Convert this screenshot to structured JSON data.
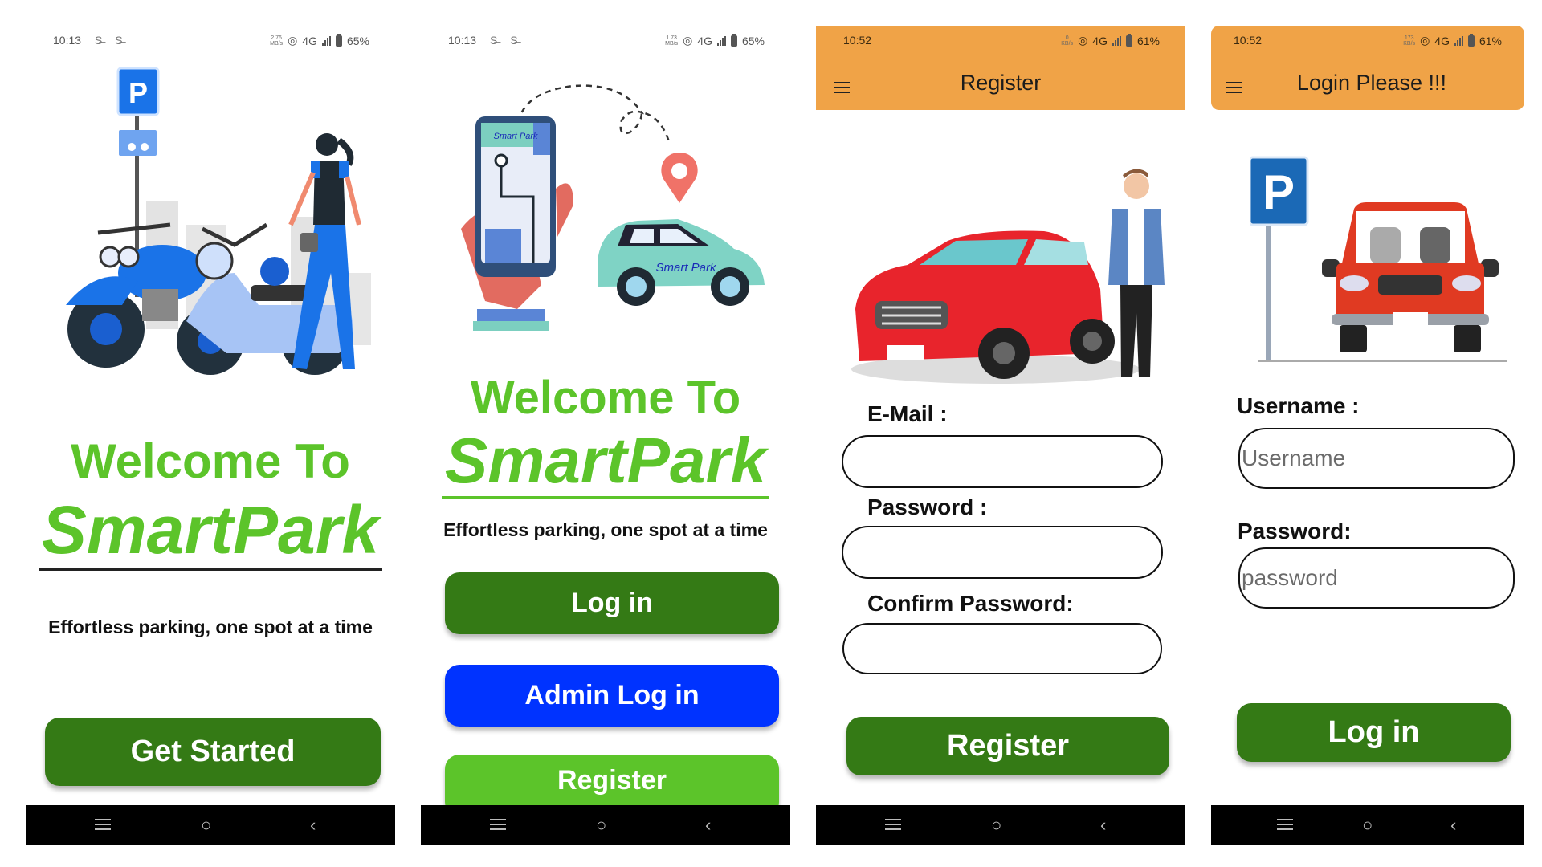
{
  "screens": [
    {
      "id": "welcome",
      "status": {
        "time": "10:13",
        "notif": "S̶ S̶",
        "speed_value": "2.76",
        "speed_unit": "MB/s",
        "network": "4G",
        "battery": "65%"
      },
      "welcome_text": "Welcome To",
      "brand": "SmartPark",
      "tagline": "Effortless parking, one spot at a time",
      "primary_button": "Get Started",
      "illustration": "motorcycles-parking-illustration"
    },
    {
      "id": "home",
      "status": {
        "time": "10:13",
        "notif": "S̶ S̶",
        "speed_value": "1.73",
        "speed_unit": "MB/s",
        "network": "4G",
        "battery": "65%"
      },
      "illustration_phone_label": "Smart Park",
      "illustration_car_label": "Smart Park",
      "welcome_text": "Welcome To",
      "brand": "SmartPark",
      "tagline": "Effortless parking, one spot at a time",
      "buttons": [
        "Log in",
        "Admin Log in",
        "Register"
      ]
    },
    {
      "id": "register",
      "status": {
        "time": "10:52",
        "speed_value": "0",
        "speed_unit": "KB/s",
        "network": "4G",
        "battery": "61%"
      },
      "title": "Register",
      "fields": [
        {
          "label": "E-Mail :",
          "value": "",
          "placeholder": ""
        },
        {
          "label": "Password :",
          "value": "",
          "placeholder": ""
        },
        {
          "label": "Confirm Password:",
          "value": "",
          "placeholder": ""
        }
      ],
      "submit": "Register"
    },
    {
      "id": "login",
      "status": {
        "time": "10:52",
        "speed_value": "173",
        "speed_unit": "KB/s",
        "network": "4G",
        "battery": "61%"
      },
      "title": "Login Please !!!",
      "fields": [
        {
          "label": "Username :",
          "value": "",
          "placeholder": "Username"
        },
        {
          "label": "Password:",
          "value": "",
          "placeholder": "password"
        }
      ],
      "submit": "Log in"
    }
  ],
  "nav_icons": [
    "recent-apps-icon",
    "home-icon",
    "back-icon"
  ],
  "colors": {
    "header": "#F0A347",
    "primary_green": "#347A15",
    "brand_green": "#5CC42A",
    "admin_blue": "#0033FF",
    "nav_bar": "#000000"
  }
}
